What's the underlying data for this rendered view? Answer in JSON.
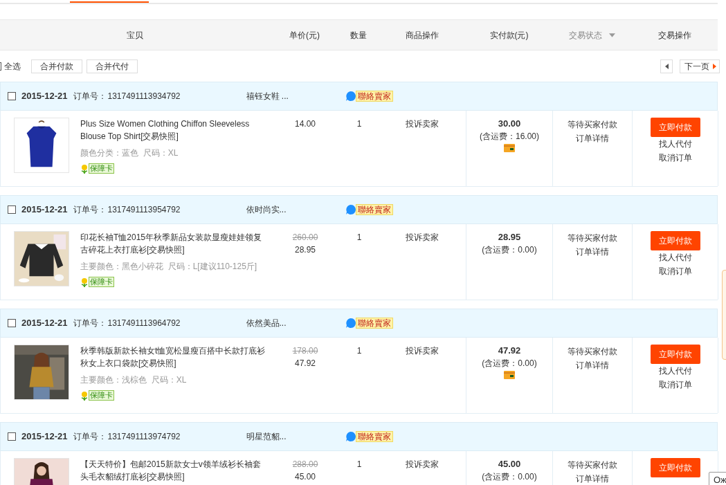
{
  "columns": [
    {
      "label": "宝贝"
    },
    {
      "label": "单价(元)"
    },
    {
      "label": "数量"
    },
    {
      "label": "商品操作"
    },
    {
      "label": "实付款(元)"
    },
    {
      "label": "交易状态",
      "dropdown": true
    },
    {
      "label": "交易操作"
    }
  ],
  "toolbar": {
    "select_all": {
      "label": "全选",
      "checked": false
    },
    "buttons": [
      "合并付款",
      "合并代付"
    ],
    "next_page": "下一页"
  },
  "orders": [
    {
      "checked": false,
      "date": "2015-12-21",
      "order_no_label": "订单号：",
      "order_no": "1317491113934792",
      "shop": "禧钰女鞋 ...",
      "contact": "聯絡賣家",
      "item": {
        "title": "Plus Size Women Clothing Chiffon Sleeveless Blouse Top Shirt[交易快照]",
        "sku": "颜色分类：蓝色  尺码：XL",
        "badge": "保障卡",
        "price": "14.00",
        "qty": "1",
        "complaint": "投诉卖家"
      },
      "total": "30.00",
      "shipping": "(含运费：16.00)",
      "card_icon": true,
      "status": "等待买家付款",
      "detail": "订单详情",
      "pay": "立即付款",
      "links": [
        "找人代付",
        "取消订单"
      ]
    },
    {
      "checked": false,
      "date": "2015-12-21",
      "order_no_label": "订单号：",
      "order_no": "1317491113954792",
      "shop": "依时尚实...",
      "contact": "聯絡賣家",
      "item": {
        "title": "印花长袖T恤2015年秋季新品女装款显瘦娃娃领复古碎花上衣打底衫[交易快照]",
        "sku": "主要颜色：黑色小碎花  尺码：L[建议110-125斤]",
        "badge": "保障卡",
        "original_price": "260.00",
        "price": "28.95",
        "qty": "1",
        "complaint": "投诉卖家"
      },
      "total": "28.95",
      "shipping": "(含运费：0.00)",
      "card_icon": false,
      "status": "等待买家付款",
      "detail": "订单详情",
      "pay": "立即付款",
      "links": [
        "找人代付",
        "取消订单"
      ]
    },
    {
      "checked": false,
      "date": "2015-12-21",
      "order_no_label": "订单号：",
      "order_no": "1317491113964792",
      "shop": "依然美品...",
      "contact": "聯絡賣家",
      "item": {
        "title": "秋季韩版新款长袖女t恤宽松显瘦百搭中长款打底衫秋女上衣口袋款[交易快照]",
        "sku": "主要颜色：浅棕色  尺码：XL",
        "badge": "保障卡",
        "original_price": "178.00",
        "price": "47.92",
        "qty": "1",
        "complaint": "投诉卖家"
      },
      "total": "47.92",
      "shipping": "(含运费：0.00)",
      "card_icon": true,
      "status": "等待买家付款",
      "detail": "订单详情",
      "pay": "立即付款",
      "links": [
        "找人代付",
        "取消订单"
      ]
    },
    {
      "checked": false,
      "date": "2015-12-21",
      "order_no_label": "订单号：",
      "order_no": "1317491113974792",
      "shop": "明星范貂...",
      "contact": "聯絡賣家",
      "item": {
        "title": "【天天特价】包邮2015新款女士v领羊绒衫长袖套头毛衣貂绒打底衫[交易快照]",
        "original_price": "288.00",
        "price": "45.00",
        "qty": "1",
        "complaint": "投诉卖家"
      },
      "total": "45.00",
      "shipping": "(含运费：0.00)",
      "card_icon": false,
      "status": "等待买家付款",
      "detail": "订单详情",
      "pay": "立即付款"
    }
  ],
  "corner_popup": "Ож"
}
